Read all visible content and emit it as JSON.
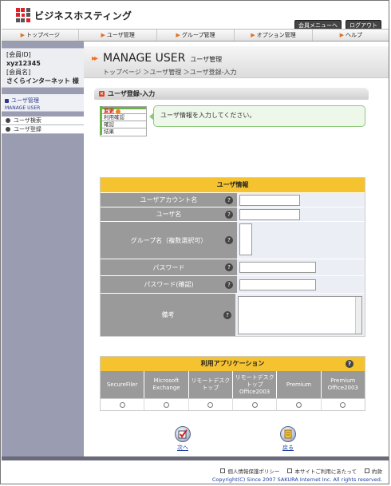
{
  "header": {
    "brand": "ビジネスホスティング",
    "links": [
      "会員メニューへ",
      "ログアウト"
    ]
  },
  "nav": {
    "items": [
      "トップページ",
      "ユーザ管理",
      "グループ管理",
      "オプション管理",
      "ヘルプ"
    ]
  },
  "sidebar": {
    "member_id_label": "[会員ID]",
    "member_id": "xyz12345",
    "member_name_label": "[会員名]",
    "member_name": "さくらインターネット 様",
    "section_title": "ユーザ管理",
    "section_sub": "MANAGE USER",
    "menu": [
      "ユーザ検索",
      "ユーザ登録"
    ]
  },
  "page": {
    "title": "MANAGE USER",
    "title_sub": "ユーザ管理",
    "breadcrumb": "トップページ ＞ユーザ管理 ＞ユーザ登録-入力",
    "section_heading": "ユーザ登録-入力"
  },
  "steps": [
    "変更",
    "利用確認",
    "確認",
    "結果"
  ],
  "message": "ユーザ情報を入力してください。",
  "form": {
    "title": "ユーザ情報",
    "fields": [
      {
        "label": "ユーザアカウント名"
      },
      {
        "label": "ユーザ名"
      },
      {
        "label": "グループ名（複数選択可）"
      },
      {
        "label": "パスワード"
      },
      {
        "label": "パスワード(確認)"
      },
      {
        "label": "備考"
      }
    ]
  },
  "apps": {
    "title": "利用アプリケーション",
    "columns": [
      "SecureFiler",
      "Microsoft Exchange",
      "リモートデスクトップ",
      "リモートデスクトップ Office2003",
      "Premium",
      "Premium Office2003"
    ]
  },
  "actions": {
    "next": "次へ",
    "back": "戻る"
  },
  "footer": {
    "links": [
      "個人情報保護ポリシー",
      "本サイトご利用にあたって",
      "約款"
    ],
    "copyright": "Copyright(C) Since 2007 SAKURA Internet Inc. All rights reserved."
  },
  "colors": {
    "accent_orange": "#f07020",
    "form_header_yellow": "#f5c230",
    "sidebar_bg": "#9a9cb2",
    "label_gray": "#9a9a9a"
  }
}
